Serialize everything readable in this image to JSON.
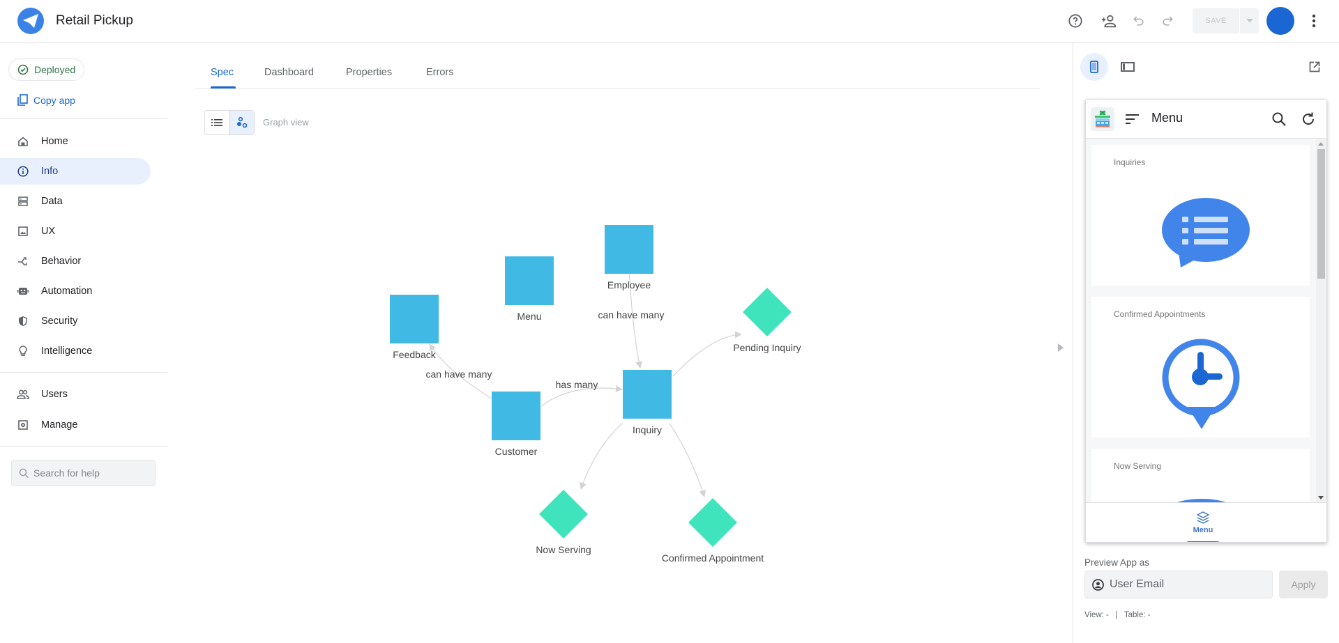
{
  "header": {
    "app_title": "Retail Pickup",
    "logo_icon": "paper-plane-icon",
    "icons": [
      "help-icon",
      "add-person-icon",
      "undo-icon",
      "redo-icon",
      "more-vert-icon"
    ],
    "save_label": "SAVE"
  },
  "sidebar": {
    "deployed_label": "Deployed",
    "copy_app_label": "Copy app",
    "nav": [
      {
        "label": "Home",
        "icon": "home-icon"
      },
      {
        "label": "Info",
        "icon": "info-icon",
        "active": true
      },
      {
        "label": "Data",
        "icon": "data-icon"
      },
      {
        "label": "UX",
        "icon": "image-icon"
      },
      {
        "label": "Behavior",
        "icon": "behavior-icon"
      },
      {
        "label": "Automation",
        "icon": "robot-icon"
      },
      {
        "label": "Security",
        "icon": "shield-icon"
      },
      {
        "label": "Intelligence",
        "icon": "lightbulb-icon"
      },
      {
        "label": "Users",
        "icon": "users-icon"
      },
      {
        "label": "Manage",
        "icon": "manage-icon"
      }
    ],
    "search_placeholder": "Search for help"
  },
  "main": {
    "tabs": [
      {
        "label": "Spec",
        "active": true
      },
      {
        "label": "Dashboard"
      },
      {
        "label": "Properties"
      },
      {
        "label": "Errors"
      }
    ],
    "view_mode_label": "Graph view",
    "graph": {
      "colors": {
        "table": "#41b9e5",
        "view": "#40e4bc",
        "edge": "#d6d6d6",
        "label": "#444444"
      },
      "nodes": [
        {
          "id": "employee",
          "label": "Employee",
          "type": "table"
        },
        {
          "id": "menu",
          "label": "Menu",
          "type": "table"
        },
        {
          "id": "feedback",
          "label": "Feedback",
          "type": "table"
        },
        {
          "id": "customer",
          "label": "Customer",
          "type": "table"
        },
        {
          "id": "inquiry",
          "label": "Inquiry",
          "type": "table"
        },
        {
          "id": "pending",
          "label": "Pending Inquiry",
          "type": "slice"
        },
        {
          "id": "nowserving",
          "label": "Now Serving",
          "type": "slice"
        },
        {
          "id": "confirmed",
          "label": "Confirmed Appointment",
          "type": "slice"
        }
      ],
      "edges": [
        {
          "from": "employee",
          "to": "inquiry",
          "label": "can have many"
        },
        {
          "from": "customer",
          "to": "feedback",
          "label": "can have many"
        },
        {
          "from": "customer",
          "to": "inquiry",
          "label": "has many"
        },
        {
          "from": "inquiry",
          "to": "pending",
          "label": ""
        },
        {
          "from": "inquiry",
          "to": "nowserving",
          "label": ""
        },
        {
          "from": "inquiry",
          "to": "confirmed",
          "label": ""
        }
      ]
    }
  },
  "preview": {
    "device_icons": [
      "phone-icon",
      "tablet-icon",
      "open-in-new-icon"
    ],
    "phone": {
      "title": "Menu",
      "cards": [
        {
          "title": "Inquiries",
          "icon": "chat-list-icon"
        },
        {
          "title": "Confirmed Appointments",
          "icon": "clock-pin-icon"
        },
        {
          "title": "Now Serving",
          "icon": "serving-icon"
        }
      ],
      "nav_label": "Menu"
    },
    "preview_as_label": "Preview App as",
    "email_placeholder": "User Email",
    "apply_label": "Apply",
    "view_table_text": "View: -   |   Table: -"
  }
}
